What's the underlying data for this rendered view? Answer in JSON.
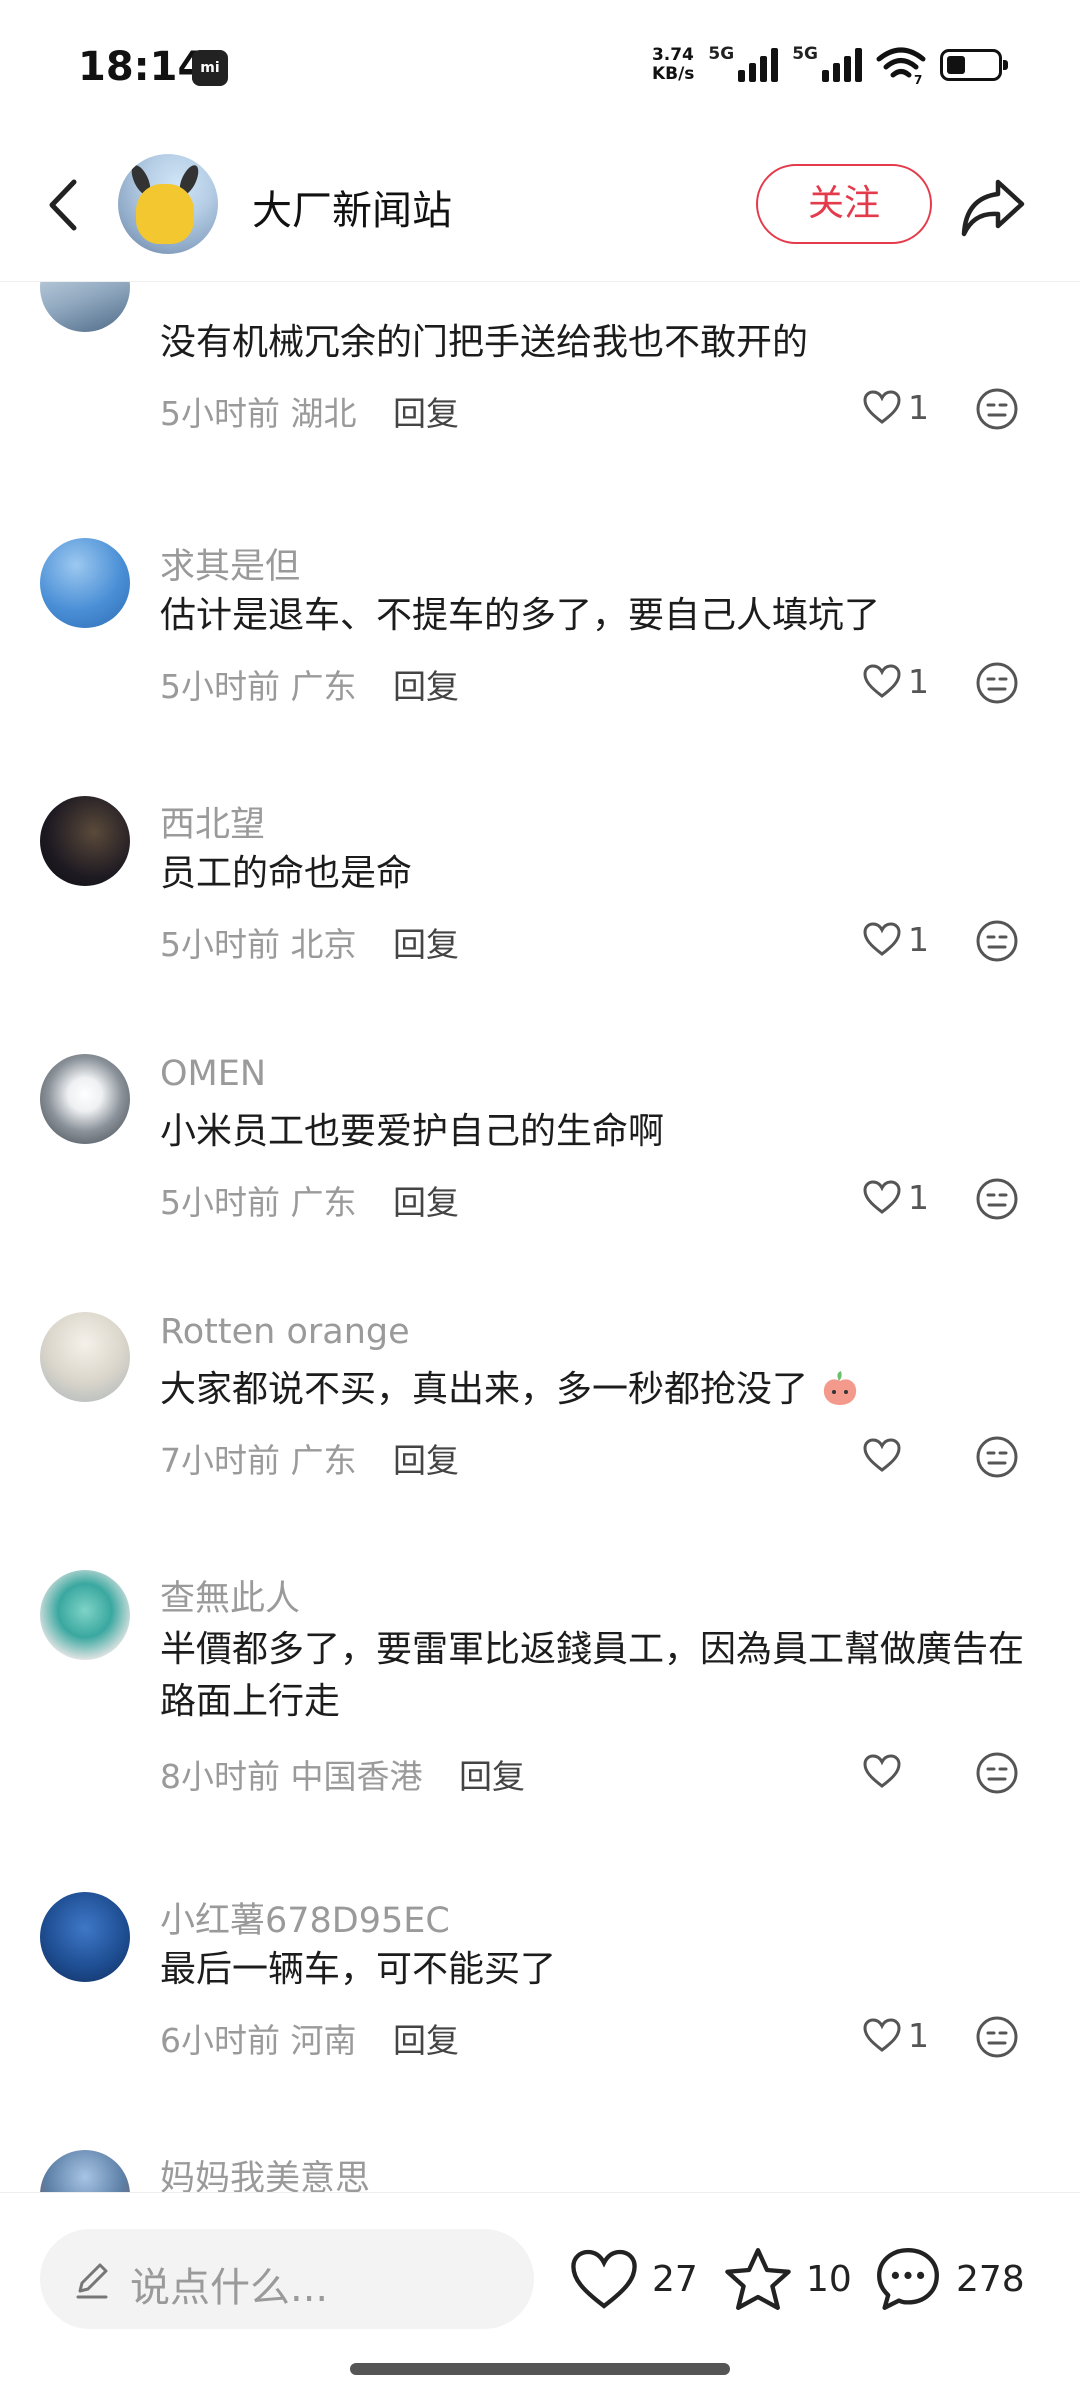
{
  "status_bar": {
    "time": "18:14",
    "mi_badge": "mi",
    "net_speed_value": "3.74",
    "net_speed_unit": "KB/s",
    "network1": "5G",
    "network2": "5G",
    "wifi_badge": "7",
    "battery_level": 0.35
  },
  "header": {
    "title": "大厂新闻站",
    "follow_label": "关注"
  },
  "comments": [
    {
      "name": "",
      "text": "没有机械冗余的门把手送给我也不敢开的",
      "time": "5小时前",
      "location": "湖北",
      "reply": "回复",
      "likes": "1"
    },
    {
      "name": "求其是但",
      "text": "估计是退车、不提车的多了，要自己人填坑了",
      "time": "5小时前",
      "location": "广东",
      "reply": "回复",
      "likes": "1"
    },
    {
      "name": "西北望",
      "text": "员工的命也是命",
      "time": "5小时前",
      "location": "北京",
      "reply": "回复",
      "likes": "1"
    },
    {
      "name": "OMEN",
      "text": "小米员工也要爱护自己的生命啊",
      "time": "5小时前",
      "location": "广东",
      "reply": "回复",
      "likes": "1"
    },
    {
      "name": "Rotten orange",
      "text": "大家都说不买，真出来，多一秒都抢没了",
      "time": "7小时前",
      "location": "广东",
      "reply": "回复",
      "likes": ""
    },
    {
      "name": "查無此人",
      "text": "半價都多了，要雷軍比返錢員工，因為員工幫做廣告在路面上行走",
      "time": "8小时前",
      "location": "中国香港",
      "reply": "回复",
      "likes": ""
    },
    {
      "name": "小红薯678D95EC",
      "text": "最后一辆车，可不能买了",
      "time": "6小时前",
      "location": "河南",
      "reply": "回复",
      "likes": "1"
    },
    {
      "name": "妈妈我美意思",
      "text": "",
      "time": "",
      "location": "",
      "reply": "",
      "likes": ""
    }
  ],
  "bottom_bar": {
    "input_placeholder": "说点什么...",
    "likes": "27",
    "favorites": "10",
    "comments": "278"
  },
  "colors": {
    "accent": "#e33b4b",
    "secondary_text": "#9a9a9a",
    "primary_text": "#1c1c1c"
  }
}
